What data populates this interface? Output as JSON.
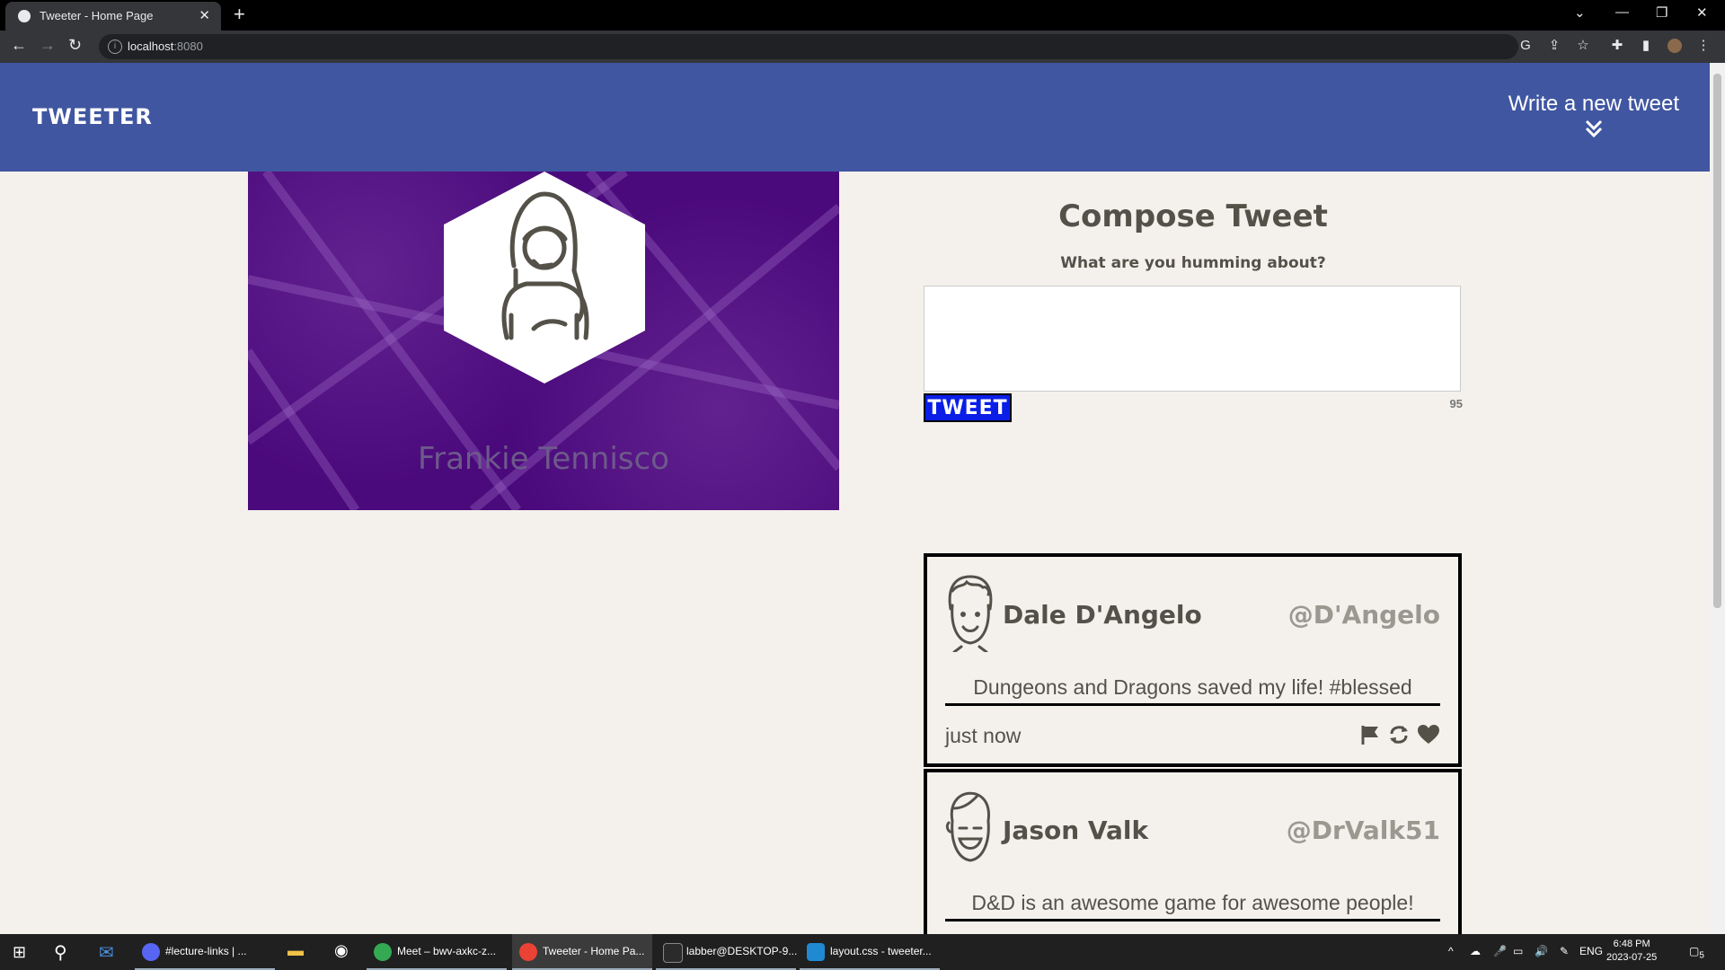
{
  "browser": {
    "tab_title": "Tweeter - Home Page",
    "url_host": "localhost",
    "url_port": ":8080"
  },
  "nav": {
    "logo": "TWEETER",
    "write_label": "Write a new tweet"
  },
  "profile": {
    "name": "Frankie Tennisco"
  },
  "compose": {
    "title": "Compose Tweet",
    "prompt": "What are you humming about?",
    "textarea_value": "",
    "button_label": "TWEET",
    "counter": "95"
  },
  "tweets": [
    {
      "name": "Dale D'Angelo",
      "handle": "@D'Angelo",
      "content": "Dungeons and Dragons saved my life! #blessed",
      "time": "just now",
      "icons": [
        "flag-icon",
        "retweet-icon",
        "heart-icon"
      ]
    },
    {
      "name": "Jason Valk",
      "handle": "@DrValk51",
      "content": "D&D is an awesome game for awesome people!"
    }
  ],
  "taskbar": {
    "apps": [
      {
        "label": "#lecture-links | ...",
        "icon": "discord-icon"
      },
      {
        "label": "Meet – bwv-axkc-z...",
        "icon": "chrome-icon"
      },
      {
        "label": "Tweeter - Home Pa...",
        "icon": "chrome-icon"
      },
      {
        "label": "labber@DESKTOP-9...",
        "icon": "terminal-icon"
      },
      {
        "label": "layout.css - tweeter...",
        "icon": "vscode-icon"
      }
    ],
    "language": "ENG",
    "time": "6:48 PM",
    "date": "2023-07-25",
    "notification_count": "5"
  },
  "colors": {
    "header": "#4056a1",
    "profile_bg": "#4b0a7c",
    "tweet_button": "#0a1ee8",
    "page_bg": "#f4f1ec"
  }
}
